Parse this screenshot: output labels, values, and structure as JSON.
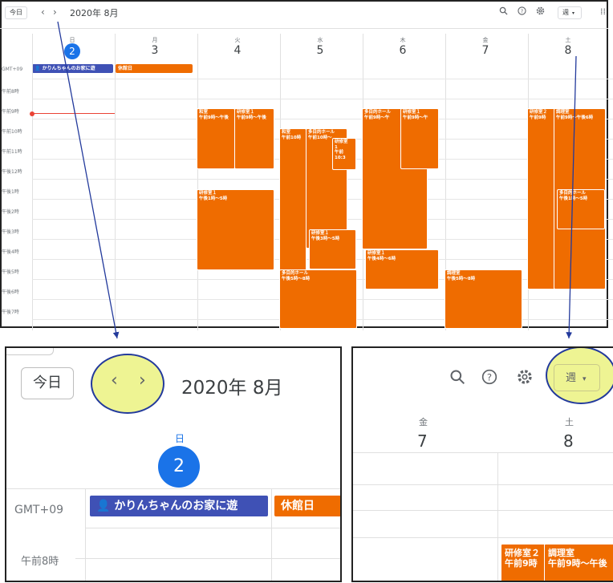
{
  "toolbar": {
    "today_label": "今日",
    "prev_icon": "‹",
    "next_icon": "›",
    "month_title": "2020年 8月",
    "view_label": "週"
  },
  "timezone": "GMT+09",
  "days": [
    {
      "name": "日",
      "num": "2",
      "today": true
    },
    {
      "name": "月",
      "num": "3"
    },
    {
      "name": "火",
      "num": "4"
    },
    {
      "name": "水",
      "num": "5"
    },
    {
      "name": "木",
      "num": "6"
    },
    {
      "name": "金",
      "num": "7"
    },
    {
      "name": "土",
      "num": "8"
    }
  ],
  "times": [
    "午前8時",
    "午前9時",
    "午前10時",
    "午前11時",
    "午後12時",
    "午後1時",
    "午後2時",
    "午後3時",
    "午後4時",
    "午後5時",
    "午後6時",
    "午後7時"
  ],
  "allday_events": [
    {
      "title": "かりんちゃんのお家に遊",
      "color": "#3f51b5"
    },
    {
      "title": "休館日",
      "color": "#ef6c00"
    }
  ],
  "events": [
    {
      "title": "和室\n午前9時〜午後",
      "day": 2
    },
    {
      "title": "研修室１\n午前9時〜午後",
      "day": 2
    },
    {
      "title": "研修室１\n午後1時〜5時",
      "day": 2
    },
    {
      "title": "和室\n午前10時",
      "day": 3
    },
    {
      "title": "多目的ホール\n午前10時〜",
      "day": 3
    },
    {
      "title": "研修室\n1\n午前10:3",
      "day": 3
    },
    {
      "title": "研修室１\n午後3時〜5時",
      "day": 3
    },
    {
      "title": "多目的ホール\n午後5時〜8時",
      "day": 3
    },
    {
      "title": "多目的ホール\n午前9時〜午",
      "day": 4
    },
    {
      "title": "研修室１\n午前9時〜午",
      "day": 4
    },
    {
      "title": "研修室１\n午後4時〜6時",
      "day": 4
    },
    {
      "title": "調理室\n午後5時〜8時",
      "day": 5
    },
    {
      "title": "研修室２\n午前9時",
      "day": 6
    },
    {
      "title": "調理室\n午前9時〜午後6時",
      "day": 6
    },
    {
      "title": "多目的ホール\n午後1時〜5時",
      "day": 6
    }
  ],
  "zoom_left": {
    "today_label": "今日",
    "month_title": "2020年 8月",
    "day_name": "日",
    "day_num": "2",
    "timezone": "GMT+09",
    "allday_title": "かりんちゃんのお家に遊",
    "allday2_title": "休館日",
    "time_label": "午前8時"
  },
  "zoom_right": {
    "view_label": "週",
    "fri_name": "金",
    "fri_num": "7",
    "sat_name": "土",
    "sat_num": "8",
    "ev1": "研修室２\n午前9時",
    "ev2": "調理室\n午前9時〜午後"
  },
  "colors": {
    "accent": "#1a73e8",
    "event": "#ef6c00",
    "allday_blue": "#3f51b5",
    "highlight": "#ebf280",
    "arrow": "#233a9c"
  }
}
